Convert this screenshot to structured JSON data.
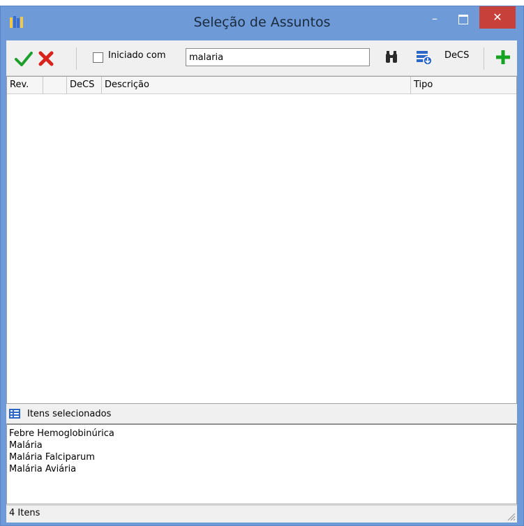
{
  "window": {
    "title": "Seleção de Assuntos"
  },
  "toolbar": {
    "starts_with_label": "Iniciado com",
    "search_value": "malaria",
    "decs_label": "DeCS"
  },
  "grid": {
    "columns": [
      "Rev.",
      "",
      "DeCS",
      "Descrição",
      "Tipo"
    ]
  },
  "selected": {
    "header": "Itens selecionados",
    "items": [
      "Febre Hemoglobinúrica",
      "Malária",
      "Malária Falciparum",
      "Malária Aviária"
    ]
  },
  "status": {
    "count": "4 Itens"
  },
  "colors": {
    "titlebar": "#6e9bd8",
    "close": "#c7413a",
    "ok": "#1e9e2a",
    "cancel": "#d8231c",
    "add": "#15a421"
  }
}
